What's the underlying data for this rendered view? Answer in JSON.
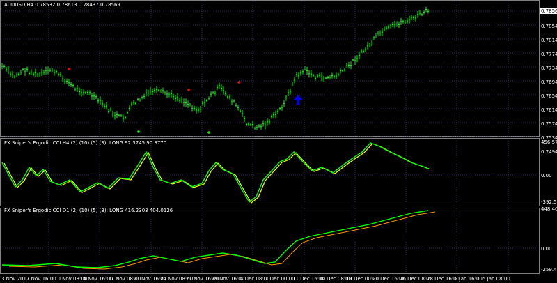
{
  "main_pane": {
    "title": "AUDUSD,H4  0.78532 0.78613 0.78437 0.78569",
    "price_box": "0.78569",
    "price_labels": [
      "0.78540",
      "0.78140",
      "0.77740",
      "0.77340",
      "0.76940",
      "0.76540",
      "0.76140",
      "0.75740",
      "0.75340",
      "0.74940"
    ]
  },
  "cci_h4_pane": {
    "title": "FX Sniper's Ergodic CCI H4 (2) (10) (5) (3): LONG 92.3745 90.3770",
    "labels": [
      "456.5781",
      "0.00",
      "-392.5235"
    ]
  },
  "cci_d1_pane": {
    "title": "FX Sniper's Ergodic CCI D1 (2) (10) (5) (3): LONG 416.2303 404.0126",
    "labels": [
      "448.4039",
      "0.00",
      "-259.4161"
    ]
  },
  "time_axis": [
    "3 Nov 2017",
    "7 Nov 16:00",
    "10 Nov 08:00",
    "14 Nov 16:00",
    "17 Nov 08:00",
    "21 Nov 16:00",
    "24 Nov 08:00",
    "27 Nov 16:00",
    "29 Nov 16:00",
    "4 Dec 08:00",
    "7 Dec 00:00",
    "11 Dec 16:00",
    "14 Dec 08:00",
    "19 Dec 00:00",
    "21 Dec 16:00",
    "26 Dec 08:00",
    "28 Dec 16:00",
    "2 Jan 16:00",
    "5 Jan 08:00"
  ],
  "colors": {
    "candle": "#00ff00",
    "signal_up": "#0000ff",
    "dot_red": "#ff0000",
    "dot_green": "#00ff00",
    "cci_green": "#00ff00",
    "cci_yellow": "#ffff00",
    "cci_orange": "#ff9900"
  },
  "icons": {
    "signal": "up-arrow-icon",
    "markers": "dot-icon"
  }
}
